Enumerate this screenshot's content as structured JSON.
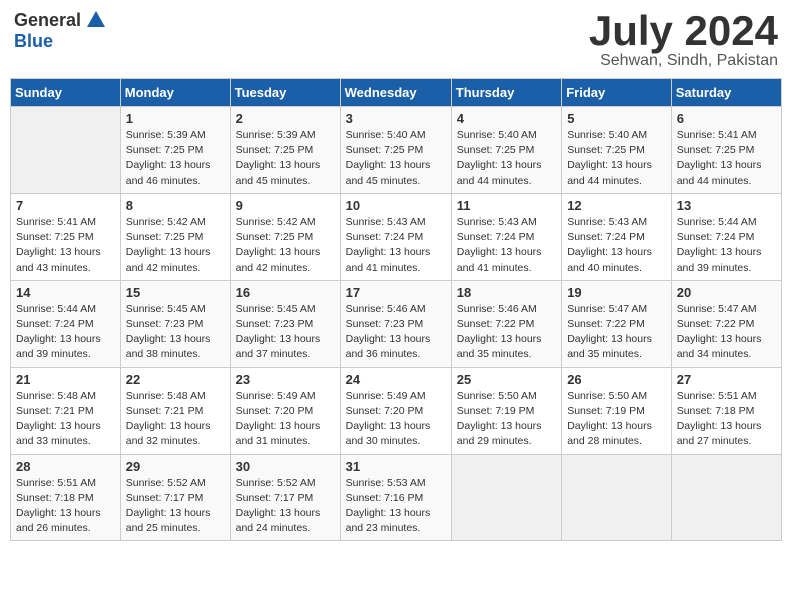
{
  "header": {
    "logo_general": "General",
    "logo_blue": "Blue",
    "month_title": "July 2024",
    "location": "Sehwan, Sindh, Pakistan"
  },
  "calendar": {
    "columns": [
      "Sunday",
      "Monday",
      "Tuesday",
      "Wednesday",
      "Thursday",
      "Friday",
      "Saturday"
    ],
    "rows": [
      [
        {
          "day": "",
          "empty": true
        },
        {
          "day": "1",
          "sunrise": "5:39 AM",
          "sunset": "7:25 PM",
          "daylight": "13 hours and 46 minutes."
        },
        {
          "day": "2",
          "sunrise": "5:39 AM",
          "sunset": "7:25 PM",
          "daylight": "13 hours and 45 minutes."
        },
        {
          "day": "3",
          "sunrise": "5:40 AM",
          "sunset": "7:25 PM",
          "daylight": "13 hours and 45 minutes."
        },
        {
          "day": "4",
          "sunrise": "5:40 AM",
          "sunset": "7:25 PM",
          "daylight": "13 hours and 44 minutes."
        },
        {
          "day": "5",
          "sunrise": "5:40 AM",
          "sunset": "7:25 PM",
          "daylight": "13 hours and 44 minutes."
        },
        {
          "day": "6",
          "sunrise": "5:41 AM",
          "sunset": "7:25 PM",
          "daylight": "13 hours and 44 minutes."
        }
      ],
      [
        {
          "day": "7",
          "sunrise": "5:41 AM",
          "sunset": "7:25 PM",
          "daylight": "13 hours and 43 minutes."
        },
        {
          "day": "8",
          "sunrise": "5:42 AM",
          "sunset": "7:25 PM",
          "daylight": "13 hours and 42 minutes."
        },
        {
          "day": "9",
          "sunrise": "5:42 AM",
          "sunset": "7:25 PM",
          "daylight": "13 hours and 42 minutes."
        },
        {
          "day": "10",
          "sunrise": "5:43 AM",
          "sunset": "7:24 PM",
          "daylight": "13 hours and 41 minutes."
        },
        {
          "day": "11",
          "sunrise": "5:43 AM",
          "sunset": "7:24 PM",
          "daylight": "13 hours and 41 minutes."
        },
        {
          "day": "12",
          "sunrise": "5:43 AM",
          "sunset": "7:24 PM",
          "daylight": "13 hours and 40 minutes."
        },
        {
          "day": "13",
          "sunrise": "5:44 AM",
          "sunset": "7:24 PM",
          "daylight": "13 hours and 39 minutes."
        }
      ],
      [
        {
          "day": "14",
          "sunrise": "5:44 AM",
          "sunset": "7:24 PM",
          "daylight": "13 hours and 39 minutes."
        },
        {
          "day": "15",
          "sunrise": "5:45 AM",
          "sunset": "7:23 PM",
          "daylight": "13 hours and 38 minutes."
        },
        {
          "day": "16",
          "sunrise": "5:45 AM",
          "sunset": "7:23 PM",
          "daylight": "13 hours and 37 minutes."
        },
        {
          "day": "17",
          "sunrise": "5:46 AM",
          "sunset": "7:23 PM",
          "daylight": "13 hours and 36 minutes."
        },
        {
          "day": "18",
          "sunrise": "5:46 AM",
          "sunset": "7:22 PM",
          "daylight": "13 hours and 35 minutes."
        },
        {
          "day": "19",
          "sunrise": "5:47 AM",
          "sunset": "7:22 PM",
          "daylight": "13 hours and 35 minutes."
        },
        {
          "day": "20",
          "sunrise": "5:47 AM",
          "sunset": "7:22 PM",
          "daylight": "13 hours and 34 minutes."
        }
      ],
      [
        {
          "day": "21",
          "sunrise": "5:48 AM",
          "sunset": "7:21 PM",
          "daylight": "13 hours and 33 minutes."
        },
        {
          "day": "22",
          "sunrise": "5:48 AM",
          "sunset": "7:21 PM",
          "daylight": "13 hours and 32 minutes."
        },
        {
          "day": "23",
          "sunrise": "5:49 AM",
          "sunset": "7:20 PM",
          "daylight": "13 hours and 31 minutes."
        },
        {
          "day": "24",
          "sunrise": "5:49 AM",
          "sunset": "7:20 PM",
          "daylight": "13 hours and 30 minutes."
        },
        {
          "day": "25",
          "sunrise": "5:50 AM",
          "sunset": "7:19 PM",
          "daylight": "13 hours and 29 minutes."
        },
        {
          "day": "26",
          "sunrise": "5:50 AM",
          "sunset": "7:19 PM",
          "daylight": "13 hours and 28 minutes."
        },
        {
          "day": "27",
          "sunrise": "5:51 AM",
          "sunset": "7:18 PM",
          "daylight": "13 hours and 27 minutes."
        }
      ],
      [
        {
          "day": "28",
          "sunrise": "5:51 AM",
          "sunset": "7:18 PM",
          "daylight": "13 hours and 26 minutes."
        },
        {
          "day": "29",
          "sunrise": "5:52 AM",
          "sunset": "7:17 PM",
          "daylight": "13 hours and 25 minutes."
        },
        {
          "day": "30",
          "sunrise": "5:52 AM",
          "sunset": "7:17 PM",
          "daylight": "13 hours and 24 minutes."
        },
        {
          "day": "31",
          "sunrise": "5:53 AM",
          "sunset": "7:16 PM",
          "daylight": "13 hours and 23 minutes."
        },
        {
          "day": "",
          "empty": true
        },
        {
          "day": "",
          "empty": true
        },
        {
          "day": "",
          "empty": true
        }
      ]
    ]
  }
}
